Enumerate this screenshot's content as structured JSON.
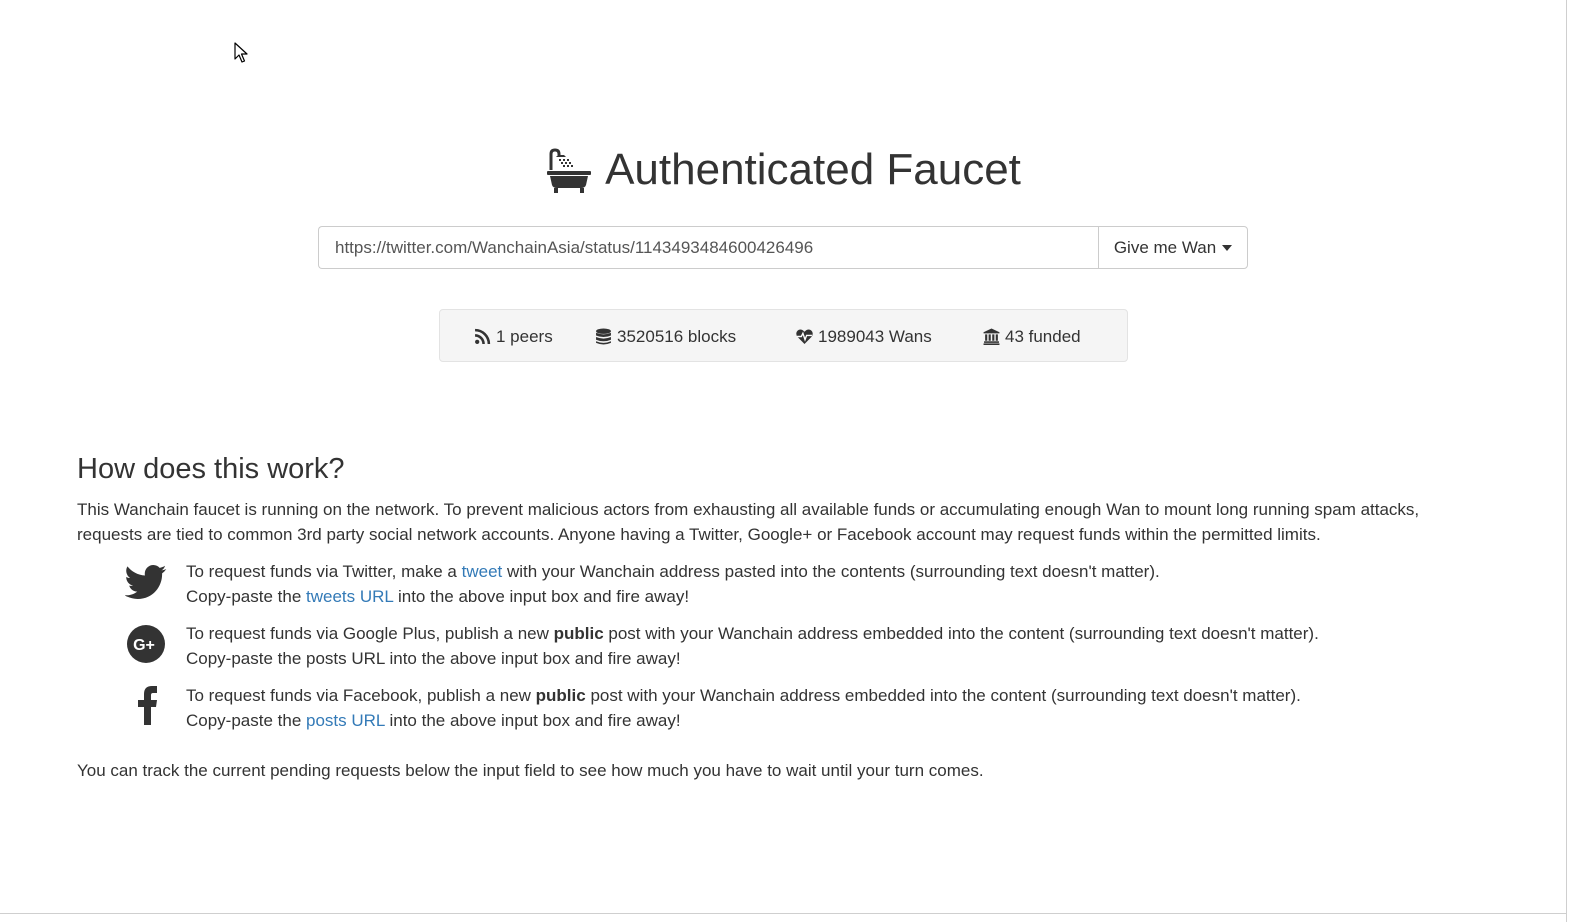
{
  "header": {
    "icon": "bath-icon",
    "title": "Authenticated Faucet"
  },
  "request": {
    "url_value": "https://twitter.com/WanchainAsia/status/1143493484600426496",
    "button_label": "Give me Wan"
  },
  "stats": {
    "peers": "1 peers",
    "blocks": "3520516 blocks",
    "wans": "1989043 Wans",
    "funded": "43 funded"
  },
  "how": {
    "title": "How does this work?",
    "intro_line1": "This Wanchain faucet is running on the network. To prevent malicious actors from exhausting all available funds or accumulating enough Wan to mount long running spam attacks,",
    "intro_line2": "requests are tied to common 3rd party social network accounts. Anyone having a Twitter, Google+ or Facebook account may request funds within the permitted limits.",
    "twitter": {
      "pre": "To request funds via Twitter, make a ",
      "link1": "tweet",
      "post": " with your Wanchain address pasted into the contents (surrounding text doesn't matter).",
      "line2_pre": "Copy-paste the ",
      "link2": "tweets URL",
      "line2_post": " into the above input box and fire away!"
    },
    "google": {
      "pre": "To request funds via Google Plus, publish a new ",
      "bold": "public",
      "post": " post with your Wanchain address embedded into the content (surrounding text doesn't matter).",
      "line2": "Copy-paste the posts URL into the above input box and fire away!"
    },
    "facebook": {
      "pre": "To request funds via Facebook, publish a new ",
      "bold": "public",
      "post": " post with your Wanchain address embedded into the content (surrounding text doesn't matter).",
      "line2_pre": "Copy-paste the ",
      "link2": "posts URL",
      "line2_post": " into the above input box and fire away!"
    },
    "outro": "You can track the current pending requests below the input field to see how much you have to wait until your turn comes."
  }
}
